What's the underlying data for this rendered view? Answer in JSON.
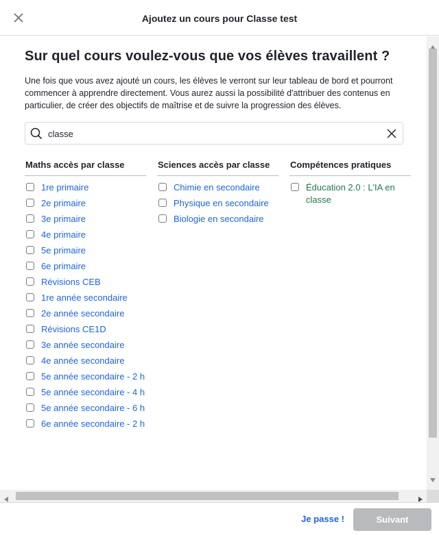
{
  "header": {
    "title": "Ajoutez un cours pour Classe test"
  },
  "main": {
    "heading": "Sur quel cours voulez-vous que vos élèves travaillent ?",
    "description": "Une fois que vous avez ajouté un cours, les élèves le verront sur leur tableau de bord et pourront commencer à apprendre directement. Vous aurez aussi la possibilité d'attribuer des contenus en particulier, de créer des objectifs de maîtrise et de suivre la progression des élèves.",
    "search": {
      "value": "classe"
    },
    "columns": [
      {
        "title": "Maths accès par classe",
        "items": [
          "1re primaire",
          "2e primaire",
          "3e primaire",
          "4e primaire",
          "5e primaire",
          "6e primaire",
          "Révisions CEB",
          "1re année secondaire",
          "2e année secondaire",
          "Révisions CE1D",
          "3e année secondaire",
          "4e année secondaire",
          "5e année secondaire - 2 h",
          "5e année secondaire - 4 h",
          "5e année secondaire - 6 h",
          "6e année secondaire - 2 h"
        ]
      },
      {
        "title": "Sciences accès par classe",
        "items": [
          "Chimie en secondaire",
          "Physique en secondaire",
          "Biologie en secondaire"
        ]
      },
      {
        "title": "Compétences pratiques",
        "items": [
          "Éducation 2.0 : L'IA en classe"
        ]
      }
    ]
  },
  "footer": {
    "skip_label": "Je passe !",
    "next_label": "Suivant"
  },
  "colors": {
    "link": "#1865f2",
    "green_link": "#1a7a4a",
    "disabled_button": "#b8babd"
  }
}
